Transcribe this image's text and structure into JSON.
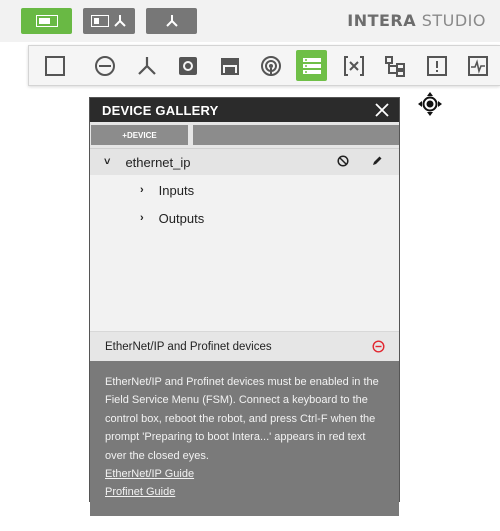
{
  "app": {
    "brand_bold": "INTERA",
    "brand_light": "STUDIO"
  },
  "topbar": {
    "buttons": [
      {
        "name": "mode-toggle",
        "icon": "toggle-icon",
        "color": "#69b944"
      },
      {
        "name": "view-combo",
        "icon": "panel-robot-icon",
        "color": "#777777"
      },
      {
        "name": "robot-view",
        "icon": "robot-icon",
        "color": "#777777"
      }
    ]
  },
  "palette": {
    "items": [
      {
        "icon": "square-icon",
        "active": false
      },
      {
        "icon": "node-icon",
        "active": false
      },
      {
        "icon": "branch-icon",
        "active": false
      },
      {
        "icon": "camera-icon",
        "active": false
      },
      {
        "icon": "print-icon",
        "active": false
      },
      {
        "icon": "signal-icon",
        "active": false
      },
      {
        "icon": "device-list-icon",
        "active": true
      },
      {
        "icon": "variable-icon",
        "active": false
      },
      {
        "icon": "hierarchy-icon",
        "active": false
      },
      {
        "icon": "alert-icon",
        "active": false
      },
      {
        "icon": "waveform-icon",
        "active": false
      }
    ],
    "active_color": "#6fbf47"
  },
  "gallery": {
    "title": "DEVICE GALLERY",
    "add_device_label": "+DEVICE",
    "device": {
      "name": "ethernet_ip",
      "children": [
        "Inputs",
        "Outputs"
      ]
    },
    "info": {
      "title": "EtherNet/IP and Profinet devices",
      "body": "EtherNet/IP and Profinet devices must be enabled in the Field Service Menu (FSM). Connect a keyboard to the control box, reboot the robot, and press Ctrl-F when the prompt 'Preparing to boot Intera...' appears in red text over the closed eyes.",
      "links": [
        "EtherNet/IP Guide",
        "Profinet Guide"
      ]
    }
  }
}
